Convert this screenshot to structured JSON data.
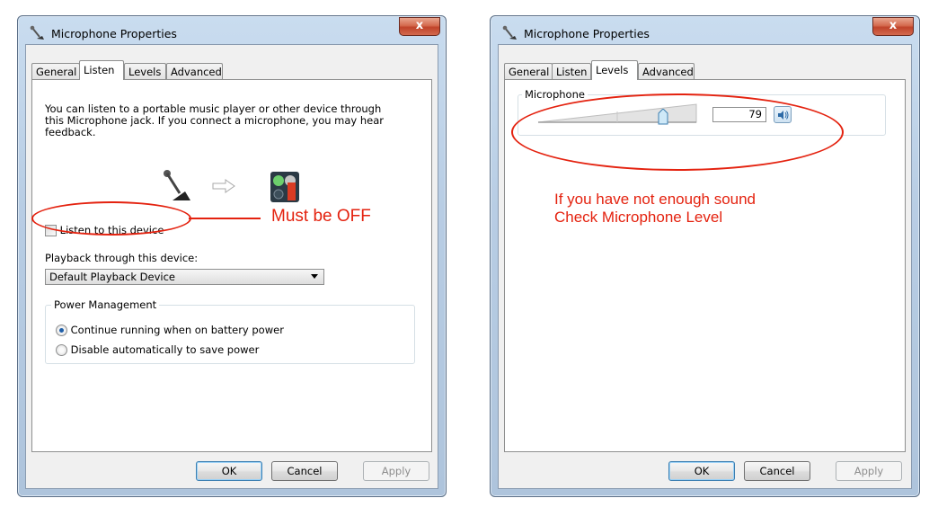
{
  "window1": {
    "title": "Microphone Properties",
    "close_label": "x",
    "tabs": [
      "General",
      "Listen",
      "Levels",
      "Advanced"
    ],
    "active_tab": "Listen",
    "description": "You can listen to a portable music player or other device through\nthis Microphone jack.  If you connect a microphone, you may hear\nfeedback.",
    "listen_checkbox_label": "Listen to this device",
    "listen_checked": false,
    "playback_label": "Playback through this device:",
    "playback_value": "Default Playback Device",
    "power_group_title": "Power Management",
    "power_options": [
      "Continue running when on battery power",
      "Disable automatically to save power"
    ],
    "power_selected": 0,
    "buttons": {
      "ok": "OK",
      "cancel": "Cancel",
      "apply": "Apply"
    },
    "annotation": "Must be OFF"
  },
  "window2": {
    "title": "Microphone Properties",
    "close_label": "x",
    "tabs": [
      "General",
      "Listen",
      "Levels",
      "Advanced"
    ],
    "active_tab": "Levels",
    "mic_group_label": "Microphone",
    "mic_level": 79,
    "speaker_icon": "speaker-icon",
    "buttons": {
      "ok": "OK",
      "cancel": "Cancel",
      "apply": "Apply"
    },
    "annotation_line1": "If you have not enough sound",
    "annotation_line2": "Check Microphone Level"
  },
  "colors": {
    "annotation": "#e4220f",
    "accent": "#1f5fa8"
  }
}
